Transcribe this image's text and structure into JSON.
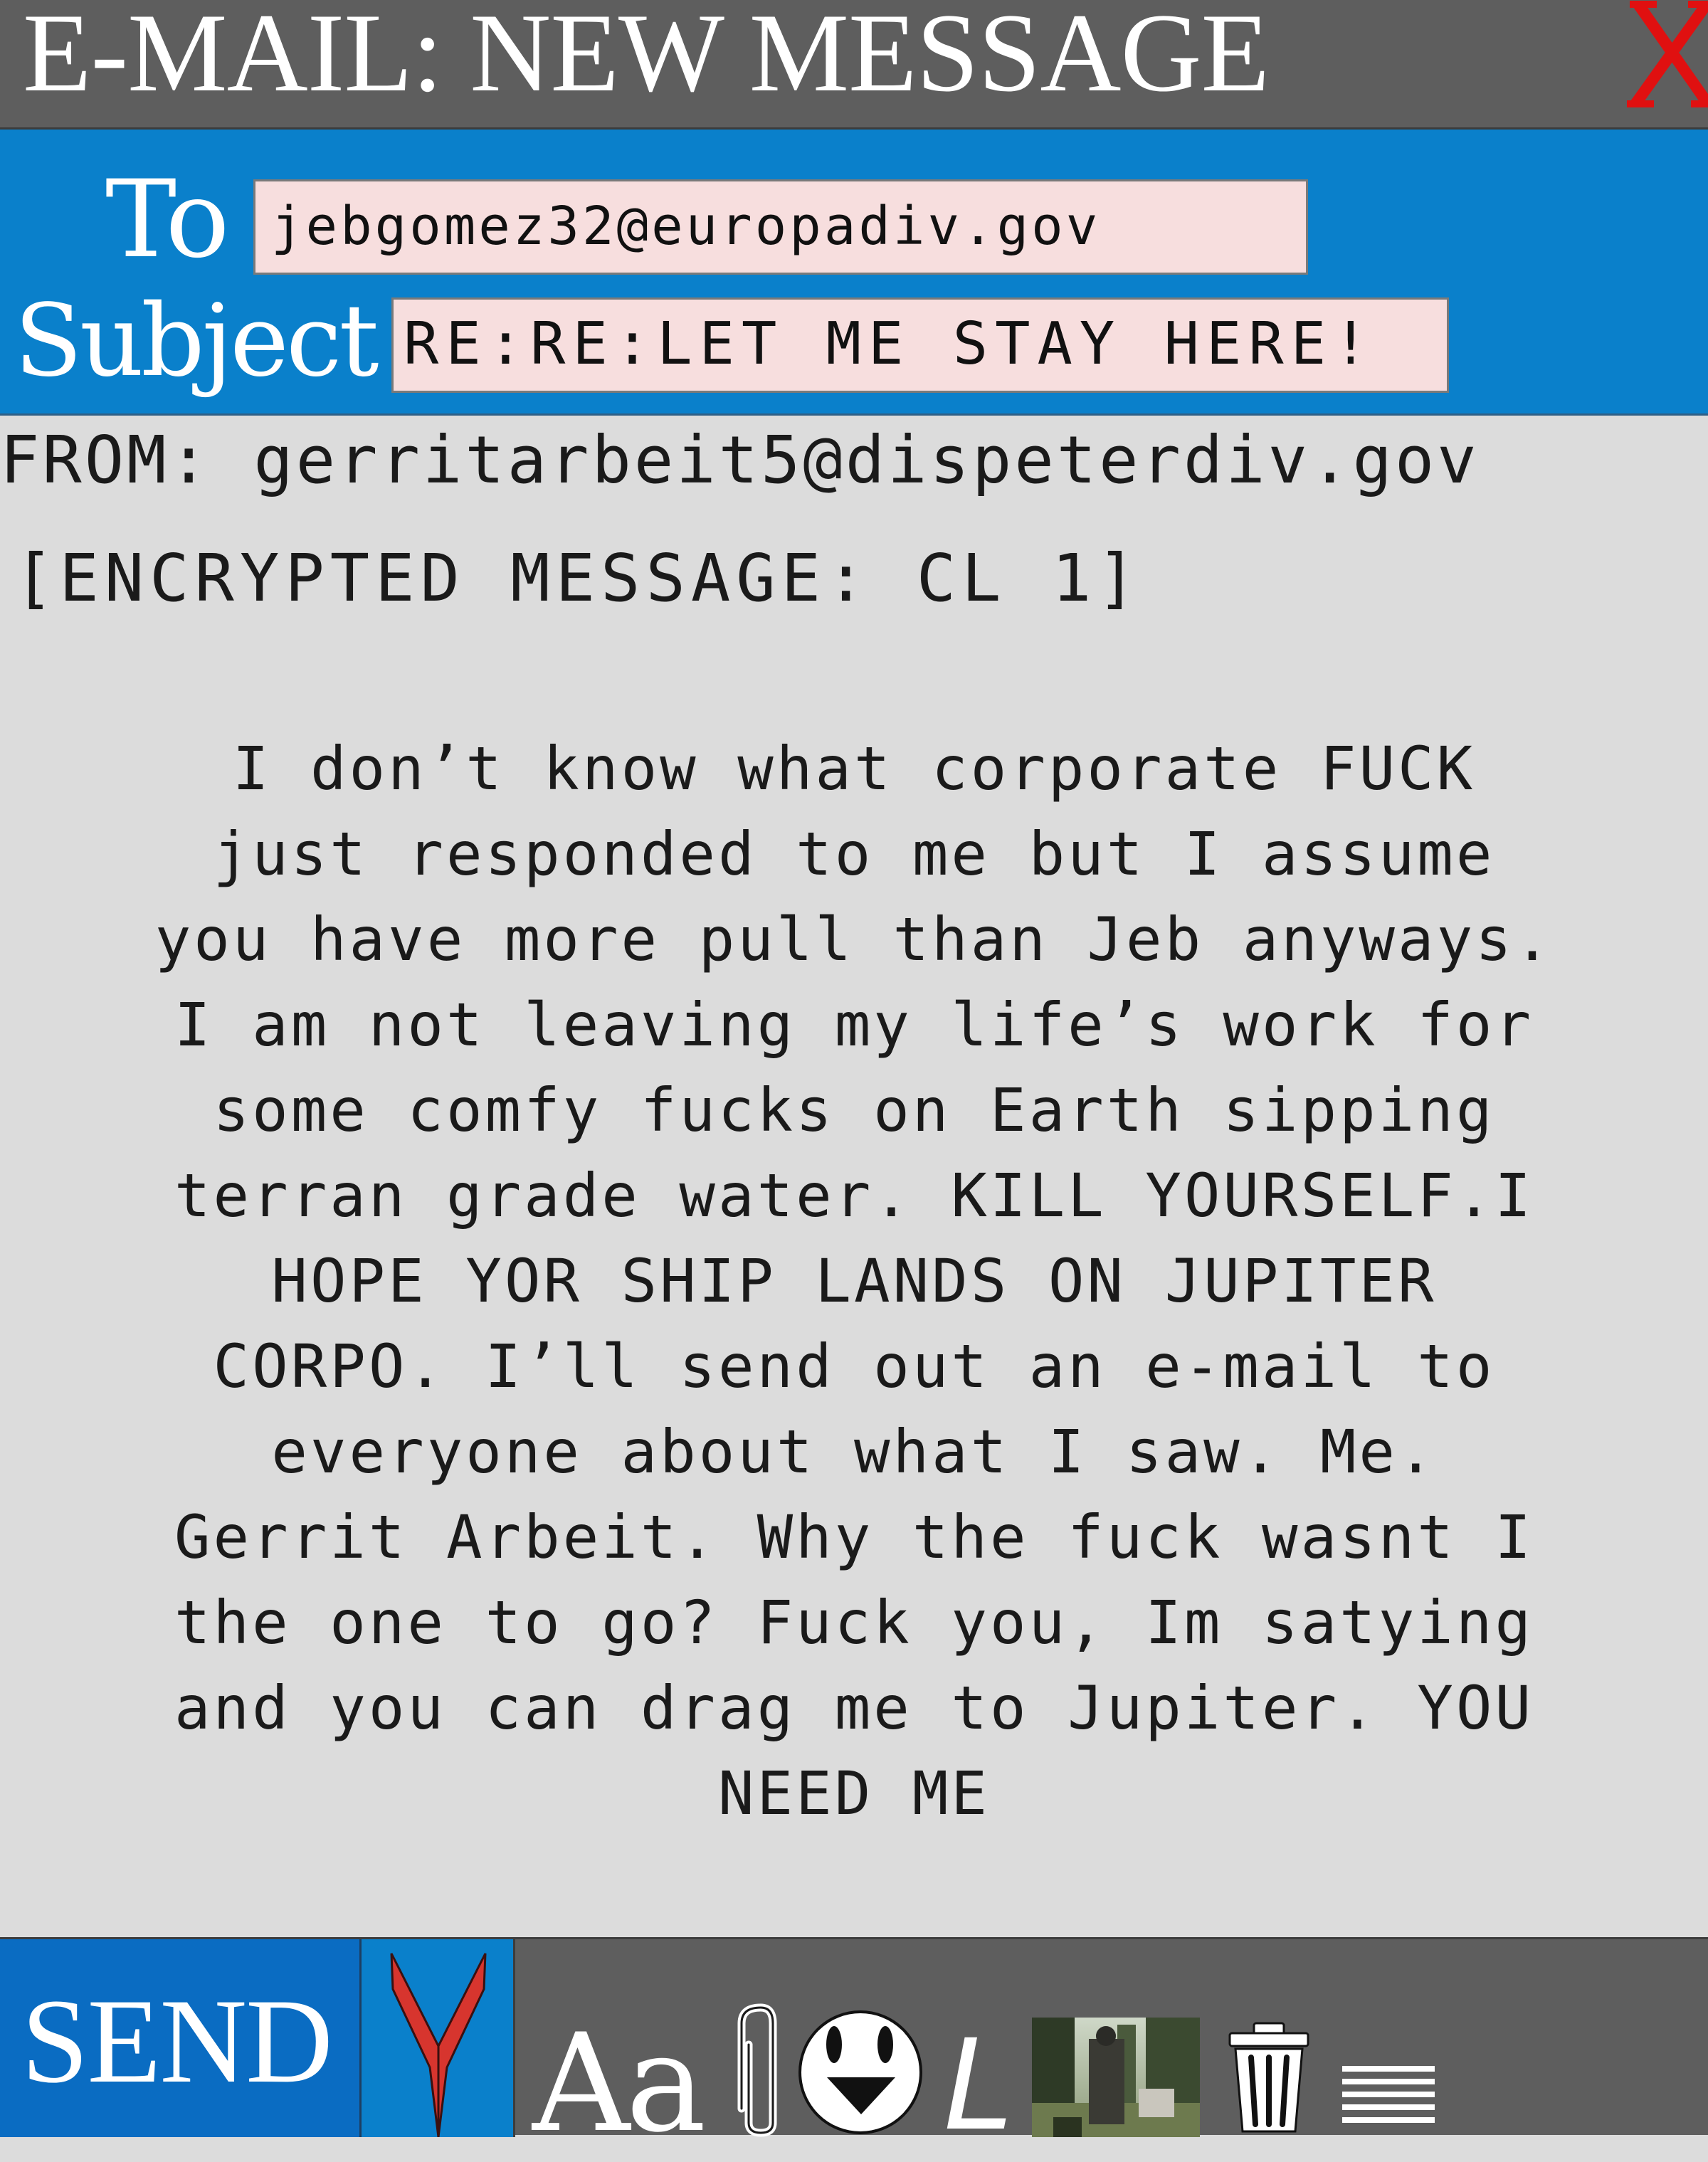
{
  "window": {
    "title": "E-MAIL: NEW MESSAGE",
    "close_label": "X"
  },
  "compose": {
    "to_label": "To",
    "to_value": "jebgomez32@europadiv.gov",
    "subject_label": "Subject",
    "subject_value": "RE:RE:LET ME STAY HERE!"
  },
  "message": {
    "from_line": "FROM: gerritarbeit5@dispeterdiv.gov",
    "encryption_tag": "[ENCRYPTED MESSAGE: CL 1]",
    "body_lines": [
      "I don’t know what corporate FUCK",
      "just responded to me but I assume",
      "you have more pull than Jeb anyways.",
      "I am not leaving my life’s work for",
      "some comfy fucks on Earth sipping",
      "terran grade water. KILL YOURSELF.I",
      "HOPE YOR SHIP LANDS ON JUPITER",
      "CORPO. I’ll send out an e-mail to",
      "everyone about what I saw. Me.",
      "Gerrit Arbeit. Why the fuck wasnt I",
      "the one to go? Fuck you, Im satying",
      "and you can drag me to Jupiter. YOU",
      "NEED ME"
    ]
  },
  "toolbar": {
    "send_label": "SEND",
    "font_label": "Aa",
    "italic_label": "L",
    "icons": [
      "emblem-icon",
      "font-icon",
      "paperclip-icon",
      "smiley-icon",
      "italic-icon",
      "photo-thumbnail",
      "trash-icon",
      "align-icon"
    ]
  },
  "colors": {
    "title_bar": "#5e5e5e",
    "header_blue": "#0a80cb",
    "send_blue": "#0a6cc2",
    "field_pink": "#f7dede",
    "body_gray": "#dcdcdc",
    "close_red": "#e01010",
    "emblem_red": "#d7352e"
  }
}
